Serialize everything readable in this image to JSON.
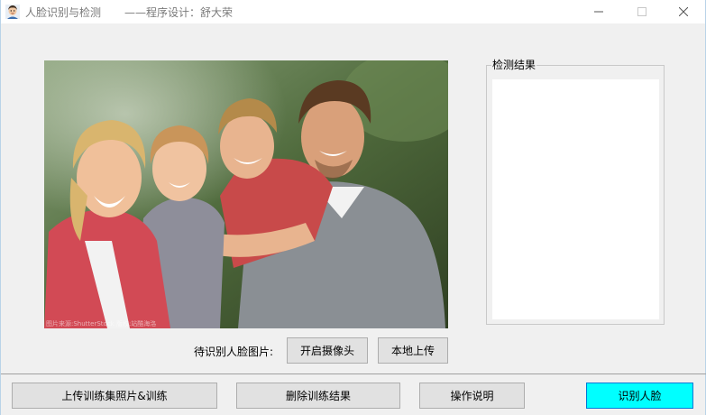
{
  "window": {
    "title": "人脸识别与检测",
    "subtitle": "——程序设计：舒大荣",
    "icon": "face-avatar-icon",
    "controls": {
      "minimize": "—",
      "maximize": "☐",
      "close": "✕"
    }
  },
  "photo": {
    "description_icon": "family-photo",
    "watermark": "图片来源:ShutterStock 版权:站酷海洛"
  },
  "results": {
    "group_label": "检测结果"
  },
  "image_controls": {
    "pending_label": "待识别人脸图片:",
    "camera_button": "开启摄像头",
    "upload_button": "本地上传"
  },
  "bottom_bar": {
    "train_button": "上传训练集照片&训练",
    "delete_button": "删除训练结果",
    "help_button": "操作说明",
    "recognize_button": "识别人脸"
  },
  "colors": {
    "recognize_accent": "#00ffff",
    "focus_border": "#0078d7"
  }
}
